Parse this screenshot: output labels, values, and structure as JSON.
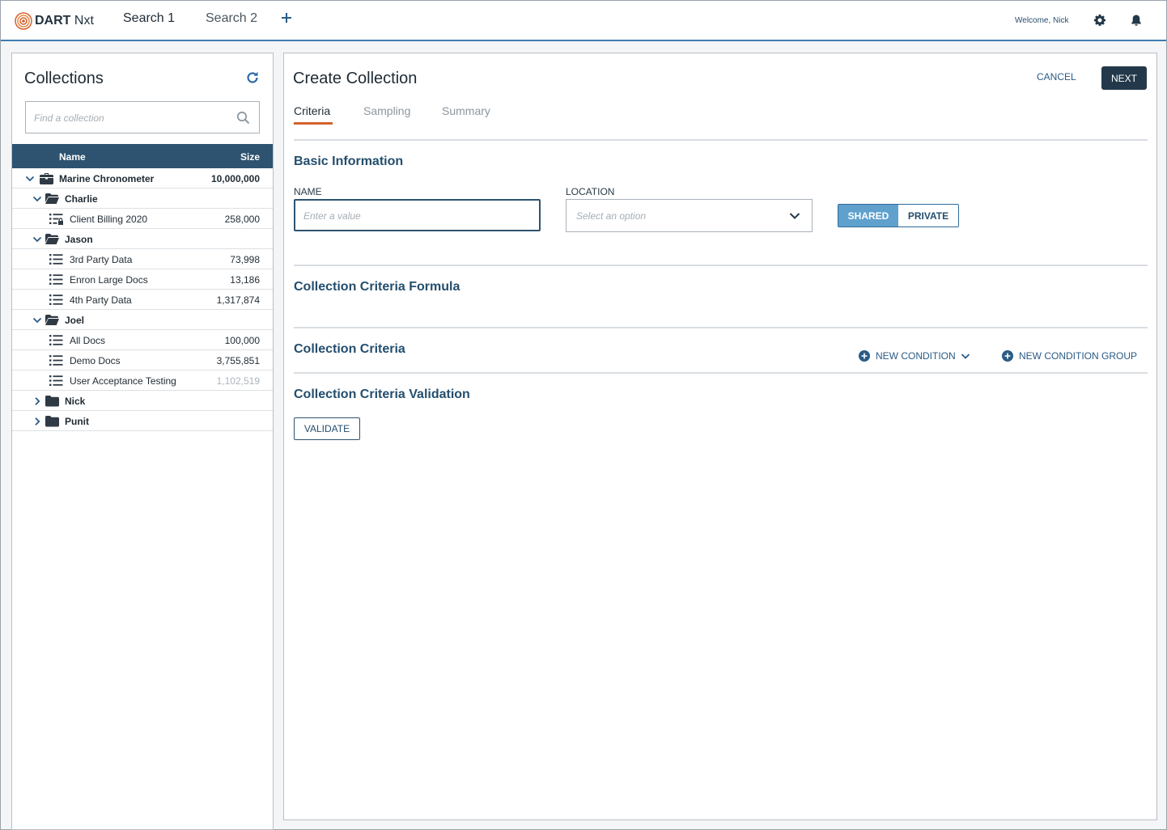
{
  "app": {
    "logo_bold": "DART",
    "logo_light": "Nxt",
    "tabs": [
      {
        "label": "Search 1"
      },
      {
        "label": "Search 2"
      }
    ],
    "add_tab_icon": "plus-icon",
    "welcome": "Welcome, Nick",
    "settings_icon": "gear-icon",
    "notifications_icon": "bell-icon",
    "accent": "#3e7bb0"
  },
  "collections": {
    "title": "Collections",
    "refresh_icon": "refresh-icon",
    "search": {
      "placeholder": "Find a collection",
      "value": ""
    },
    "columns": {
      "name": "Name",
      "size": "Size"
    },
    "header_color": "#2e5370",
    "rows": [
      {
        "level": 0,
        "type": "root",
        "expanded": true,
        "label": "Marine Chronometer",
        "size": "10,000,000",
        "bold": true
      },
      {
        "level": 1,
        "type": "folder-open",
        "expanded": true,
        "label": "Charlie",
        "size": "",
        "bold": true
      },
      {
        "level": 2,
        "type": "list-locked",
        "label": "Client Billing 2020",
        "size": "258,000"
      },
      {
        "level": 1,
        "type": "folder-open",
        "expanded": true,
        "label": "Jason",
        "size": "",
        "bold": true
      },
      {
        "level": 2,
        "type": "list",
        "label": "3rd Party Data",
        "size": "73,998"
      },
      {
        "level": 2,
        "type": "list",
        "label": "Enron Large Docs",
        "size": "13,186"
      },
      {
        "level": 2,
        "type": "list",
        "label": "4th Party Data",
        "size": "1,317,874"
      },
      {
        "level": 1,
        "type": "folder-open",
        "expanded": true,
        "label": "Joel",
        "size": "",
        "bold": true
      },
      {
        "level": 2,
        "type": "list",
        "label": "All Docs",
        "size": "100,000"
      },
      {
        "level": 2,
        "type": "list",
        "label": "Demo Docs",
        "size": "3,755,851"
      },
      {
        "level": 2,
        "type": "list",
        "label": "User Acceptance Testing",
        "size": "1,102,519",
        "muted": true
      },
      {
        "level": 1,
        "type": "folder-closed",
        "expanded": false,
        "label": "Nick",
        "size": "",
        "bold": true
      },
      {
        "level": 1,
        "type": "folder-closed",
        "expanded": false,
        "label": "Punit",
        "size": "",
        "bold": true
      }
    ]
  },
  "create": {
    "title": "Create Collection",
    "cancel_label": "CANCEL",
    "next_label": "NEXT",
    "tabs": [
      {
        "label": "Criteria",
        "active": true
      },
      {
        "label": "Sampling",
        "active": false
      },
      {
        "label": "Summary",
        "active": false
      }
    ],
    "basic_info": {
      "heading": "Basic Information",
      "name_label": "NAME",
      "name_placeholder": "Enter a value",
      "name_value": "",
      "location_label": "LOCATION",
      "location_placeholder": "Select an option",
      "visibility_options": [
        "SHARED",
        "PRIVATE"
      ],
      "visibility_selected": "SHARED"
    },
    "formula_heading": "Collection Criteria Formula",
    "criteria_heading": "Collection Criteria",
    "new_condition_label": "NEW CONDITION",
    "new_condition_group_label": "NEW CONDITION GROUP",
    "validation_heading": "Collection Criteria Validation",
    "validate_label": "VALIDATE",
    "tab_underline_color": "#d4622c"
  }
}
